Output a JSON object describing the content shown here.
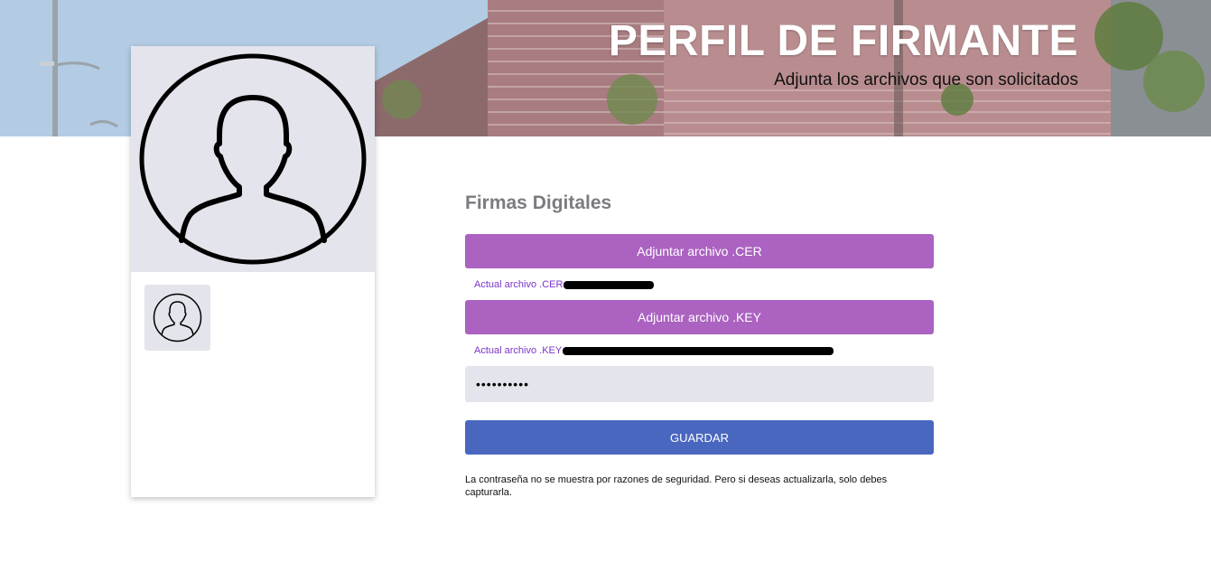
{
  "banner": {
    "title": "PERFIL DE FIRMANTE",
    "subtitle": "Adjunta los archivos que son solicitados"
  },
  "profile": {
    "avatar_icon": "user-avatar-icon",
    "thumbnail_icon": "user-avatar-icon"
  },
  "form": {
    "section_title": "Firmas Digitales",
    "cer_button_label": "Adjuntar archivo .CER",
    "cer_current_label": "Actual archivo .CER",
    "key_button_label": "Adjuntar archivo .KEY",
    "key_current_label": "Actual archivo .KEY",
    "password_value": "••••••••••",
    "save_button_label": "GUARDAR",
    "note": "La contraseña no se muestra por razones de seguridad. Pero si deseas actualizarla, solo debes capturarla."
  },
  "colors": {
    "attach_button": "#ab62c1",
    "save_button": "#4a67bf",
    "file_label": "#7b35c8",
    "input_bg": "#e4e4ec"
  }
}
